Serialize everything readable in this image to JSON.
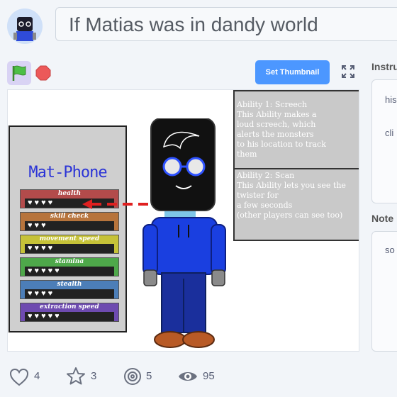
{
  "project": {
    "title": "If Matias was in dandy world"
  },
  "controls": {
    "thumbnail_label": "Set Thumbnail",
    "flag_icon": "green-flag-icon",
    "stop_icon": "stop-icon",
    "fullscreen_icon": "fullscreen-icon"
  },
  "stage": {
    "phone": {
      "title": "Mat-Phone",
      "stats": [
        {
          "label": "health",
          "hearts": "♥♥♥♥",
          "color": "#b34b4b"
        },
        {
          "label": "skill check",
          "hearts": "♥♥♥",
          "color": "#b7743c"
        },
        {
          "label": "movement speed",
          "hearts": "♥♥♥♥",
          "color": "#c6c238"
        },
        {
          "label": "stamina",
          "hearts": "♥♥♥♥♥",
          "color": "#4ea84a"
        },
        {
          "label": "stealth",
          "hearts": "♥♥♥♥",
          "color": "#4c7eb8"
        },
        {
          "label": "extraction speed",
          "hearts": "♥♥♥♥♥",
          "color": "#6e4bb0"
        }
      ]
    },
    "info": {
      "ability1": "Ability 1: Screech\nThis Ability makes a\nloud screech, which\nalerts the monsters\nto his location to track\nthem",
      "ability2": "Ability 2: Scan\nThis Ability lets you see the\ntwister for\na few seconds\n(other players can see too)"
    }
  },
  "sidebar": {
    "instructions_heading": "Instru",
    "instructions_line1": "his",
    "instructions_line2": "cli",
    "notes_heading": "Note",
    "notes_line1": "so"
  },
  "stats": {
    "loves": "4",
    "favorites": "3",
    "remixes": "5",
    "views": "95"
  }
}
